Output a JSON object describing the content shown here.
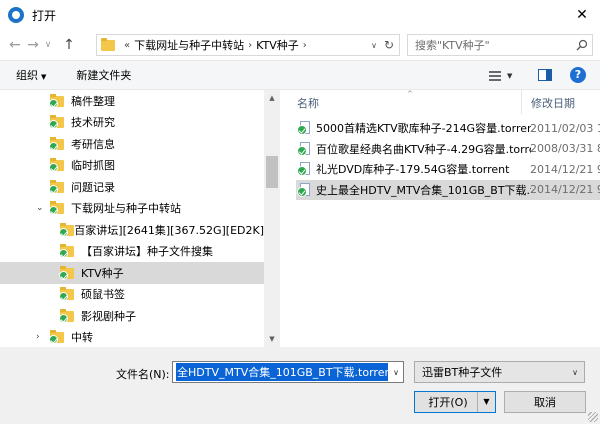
{
  "window": {
    "title": "打开",
    "close_glyph": "✕"
  },
  "nav": {
    "back": "←",
    "forward": "→",
    "recent": "∨",
    "up": "↑"
  },
  "address": {
    "overflow": "«",
    "crumbs": [
      "下载网址与种子中转站",
      "KTV种子"
    ],
    "separator": "›",
    "dropdown": "∨",
    "refresh": "↻"
  },
  "search": {
    "placeholder": "搜索\"KTV种子\""
  },
  "toolbar": {
    "organize_label": "组织",
    "organize_caret": "▼",
    "new_folder_label": "新建文件夹",
    "view_caret": "▼",
    "help_label": "?"
  },
  "sidebar": {
    "items": [
      {
        "label": "稿件整理",
        "indent": 0,
        "selected": false
      },
      {
        "label": "技术研究",
        "indent": 0,
        "selected": false
      },
      {
        "label": "考研信息",
        "indent": 0,
        "selected": false
      },
      {
        "label": "临时抓图",
        "indent": 0,
        "selected": false
      },
      {
        "label": "问题记录",
        "indent": 0,
        "selected": false
      },
      {
        "label": "下载网址与种子中转站",
        "indent": 0,
        "selected": false,
        "expanded": true
      },
      {
        "label": "[百家讲坛][2641集][367.52G][ED2K]",
        "indent": 1,
        "selected": false
      },
      {
        "label": "【百家讲坛】种子文件搜集",
        "indent": 1,
        "selected": false
      },
      {
        "label": "KTV种子",
        "indent": 1,
        "selected": true
      },
      {
        "label": "硕鼠书签",
        "indent": 1,
        "selected": false
      },
      {
        "label": "影视剧种子",
        "indent": 1,
        "selected": false
      },
      {
        "label": "中转",
        "indent": 0,
        "selected": false,
        "collapsed": true
      }
    ],
    "expand_open": "⌄",
    "expand_closed": "›"
  },
  "scrollbar": {
    "up": "▲",
    "down": "▼"
  },
  "files": {
    "columns": {
      "name": "名称",
      "date": "修改日期",
      "sort_caret": "^"
    },
    "rows": [
      {
        "name": "5000首精选KTV歌库种子-214G容量.torrent",
        "date": "2011/02/03 1",
        "selected": false
      },
      {
        "name": "百位歌星经典名曲KTV种子-4.29G容量.torrent",
        "date": "2008/03/31 8",
        "selected": false
      },
      {
        "name": "礼光DVD库种子-179.54G容量.torrent",
        "date": "2014/12/21 9",
        "selected": false
      },
      {
        "name": "史上最全HDTV_MTV合集_101GB_BT下载.torrent",
        "date": "2014/12/21 9",
        "selected": true
      }
    ]
  },
  "footer": {
    "filename_label": "文件名(N):",
    "filename_value": "全HDTV_MTV合集_101GB_BT下载.torrent",
    "filetype_value": "迅雷BT种子文件",
    "open_label": "打开(O)",
    "cancel_label": "取消",
    "combo_caret": "∨",
    "open_caret": "▼"
  }
}
